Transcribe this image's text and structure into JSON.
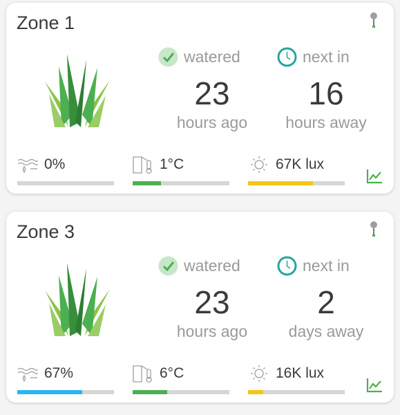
{
  "colors": {
    "moisture": "#29b6f6",
    "temperature": "#4caf50",
    "light": "#f5c518",
    "check": "#4caf50",
    "clock": "#26a69a"
  },
  "zones": [
    {
      "title": "Zone 1",
      "watered_label": "watered",
      "watered_value": "23",
      "watered_unit": "hours ago",
      "next_label": "next in",
      "next_value": "16",
      "next_unit": "hours away",
      "moisture": {
        "text": "0%",
        "level": 0.0
      },
      "temperature": {
        "text": "1°C",
        "level": 0.29
      },
      "light": {
        "text": "67K lux",
        "level": 0.67
      }
    },
    {
      "title": "Zone 3",
      "watered_label": "watered",
      "watered_value": "23",
      "watered_unit": "hours ago",
      "next_label": "next in",
      "next_value": "2",
      "next_unit": "days away",
      "moisture": {
        "text": "67%",
        "level": 0.67
      },
      "temperature": {
        "text": "6°C",
        "level": 0.36
      },
      "light": {
        "text": "16K lux",
        "level": 0.16
      }
    }
  ]
}
